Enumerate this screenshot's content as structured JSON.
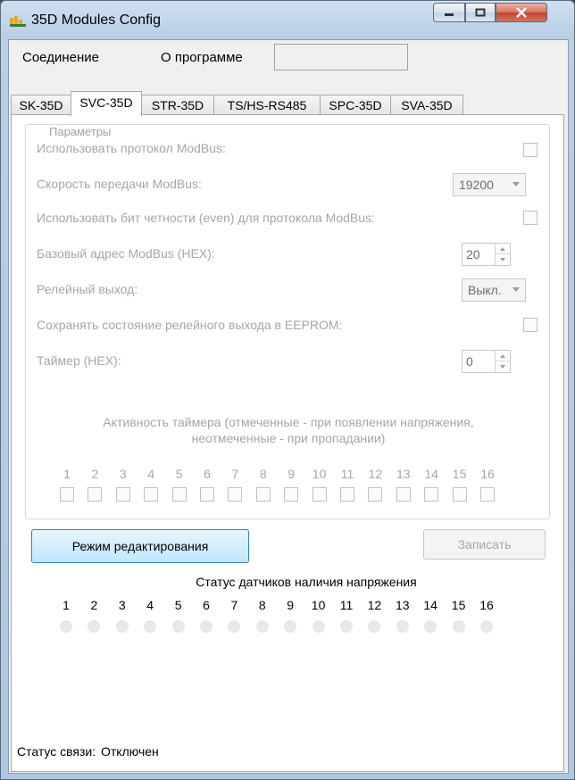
{
  "window": {
    "title": "35D Modules Config"
  },
  "menu": {
    "items": [
      "Соединение",
      "О программе"
    ]
  },
  "tabs": [
    {
      "label": "SK-35D",
      "active": false
    },
    {
      "label": "SVC-35D",
      "active": true
    },
    {
      "label": "STR-35D",
      "active": false
    },
    {
      "label": "TS/HS-RS485",
      "active": false
    },
    {
      "label": "SPC-35D",
      "active": false
    },
    {
      "label": "SVA-35D",
      "active": false
    }
  ],
  "params": {
    "group_title": "Параметры",
    "use_modbus_label": "Использовать  протокол ModBus:",
    "use_modbus_checked": false,
    "modbus_speed_label": "Скорость передачи ModBus:",
    "modbus_speed_value": "19200",
    "parity_label": "Использовать бит четности (even) для протокола ModBus:",
    "parity_checked": false,
    "base_address_label": "Базовый адрес ModBus (HEX):",
    "base_address_value": "20",
    "relay_label": "Релейный выход:",
    "relay_value": "Выкл.",
    "save_relay_label": "Сохранять состояние релейного выхода в EEPROM:",
    "save_relay_checked": false,
    "timer_label": "Таймер (HEX):",
    "timer_value": "0",
    "timer_activity_line1": "Активность таймера (отмеченные - при появлении напряжения,",
    "timer_activity_line2": "неотмеченные - при пропадании)",
    "channels": [
      "1",
      "2",
      "3",
      "4",
      "5",
      "6",
      "7",
      "8",
      "9",
      "10",
      "11",
      "12",
      "13",
      "14",
      "15",
      "16"
    ]
  },
  "buttons": {
    "edit_mode": "Режим редактирования",
    "write": "Записать"
  },
  "sensors": {
    "title": "Статус датчиков наличия напряжения",
    "channels": [
      "1",
      "2",
      "3",
      "4",
      "5",
      "6",
      "7",
      "8",
      "9",
      "10",
      "11",
      "12",
      "13",
      "14",
      "15",
      "16"
    ]
  },
  "status": {
    "label": "Статус связи:",
    "value": "Отключен"
  },
  "colors": {
    "accent_button": "#bee6fd",
    "disabled_text": "#a6a6a6",
    "close_button": "#c4432c"
  }
}
